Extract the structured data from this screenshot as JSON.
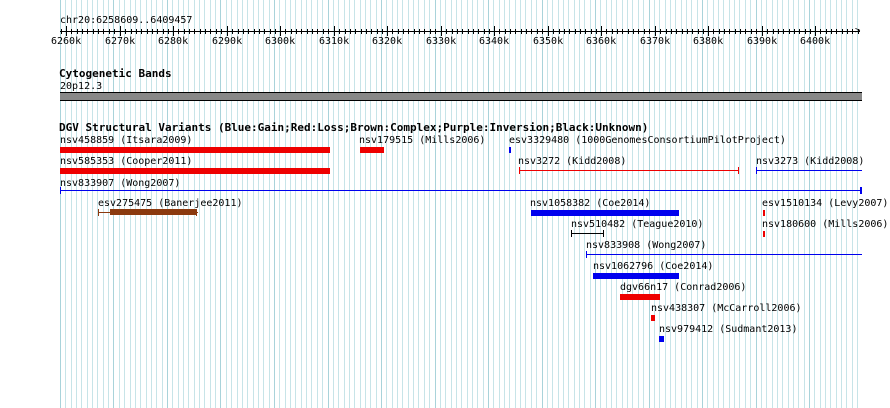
{
  "ruler": {
    "range_label": "chr20:6258609..6409457",
    "ticks": [
      "6260k",
      "6270k",
      "6280k",
      "6290k",
      "6300k",
      "6310k",
      "6320k",
      "6330k",
      "6340k",
      "6350k",
      "6360k",
      "6370k",
      "6380k",
      "6390k",
      "6400k"
    ]
  },
  "cytoband": {
    "title": "Cytogenetic Bands",
    "band_label": "20p12.3",
    "band_color": "#888888"
  },
  "dgv": {
    "title": "DGV Structural Variants (Blue:Gain;Red:Loss;Brown:Complex;Purple:Inversion;Black:Unknown)",
    "features": [
      {
        "label": "nsv458859 (Itsara2009)",
        "type": "loss"
      },
      {
        "label": "nsv179515 (Mills2006)",
        "type": "loss"
      },
      {
        "label": "esv3329480 (1000GenomesConsortiumPilotProject)",
        "type": "gain"
      },
      {
        "label": "nsv585353 (Cooper2011)",
        "type": "loss"
      },
      {
        "label": "nsv3272 (Kidd2008)",
        "type": "loss"
      },
      {
        "label": "nsv3273 (Kidd2008)",
        "type": "gain"
      },
      {
        "label": "nsv833907 (Wong2007)",
        "type": "gain"
      },
      {
        "label": "esv275475 (Banerjee2011)",
        "type": "complex"
      },
      {
        "label": "nsv1058382 (Coe2014)",
        "type": "gain"
      },
      {
        "label": "esv1510134 (Levy2007)",
        "type": "loss"
      },
      {
        "label": "nsv510482 (Teague2010)",
        "type": "unknown"
      },
      {
        "label": "nsv180600 (Mills2006)",
        "type": "loss"
      },
      {
        "label": "nsv833908 (Wong2007)",
        "type": "gain"
      },
      {
        "label": "nsv1062796 (Coe2014)",
        "type": "gain"
      },
      {
        "label": "dgv66n17 (Conrad2006)",
        "type": "loss"
      },
      {
        "label": "nsv438307 (McCarroll2006)",
        "type": "loss"
      },
      {
        "label": "nsv979412 (Sudmant2013)",
        "type": "gain"
      }
    ]
  },
  "colors": {
    "gain": "#0000ee",
    "loss": "#ee0000",
    "complex": "#8b3a0f",
    "unknown": "#000000",
    "grid": "#c7e4e8"
  }
}
